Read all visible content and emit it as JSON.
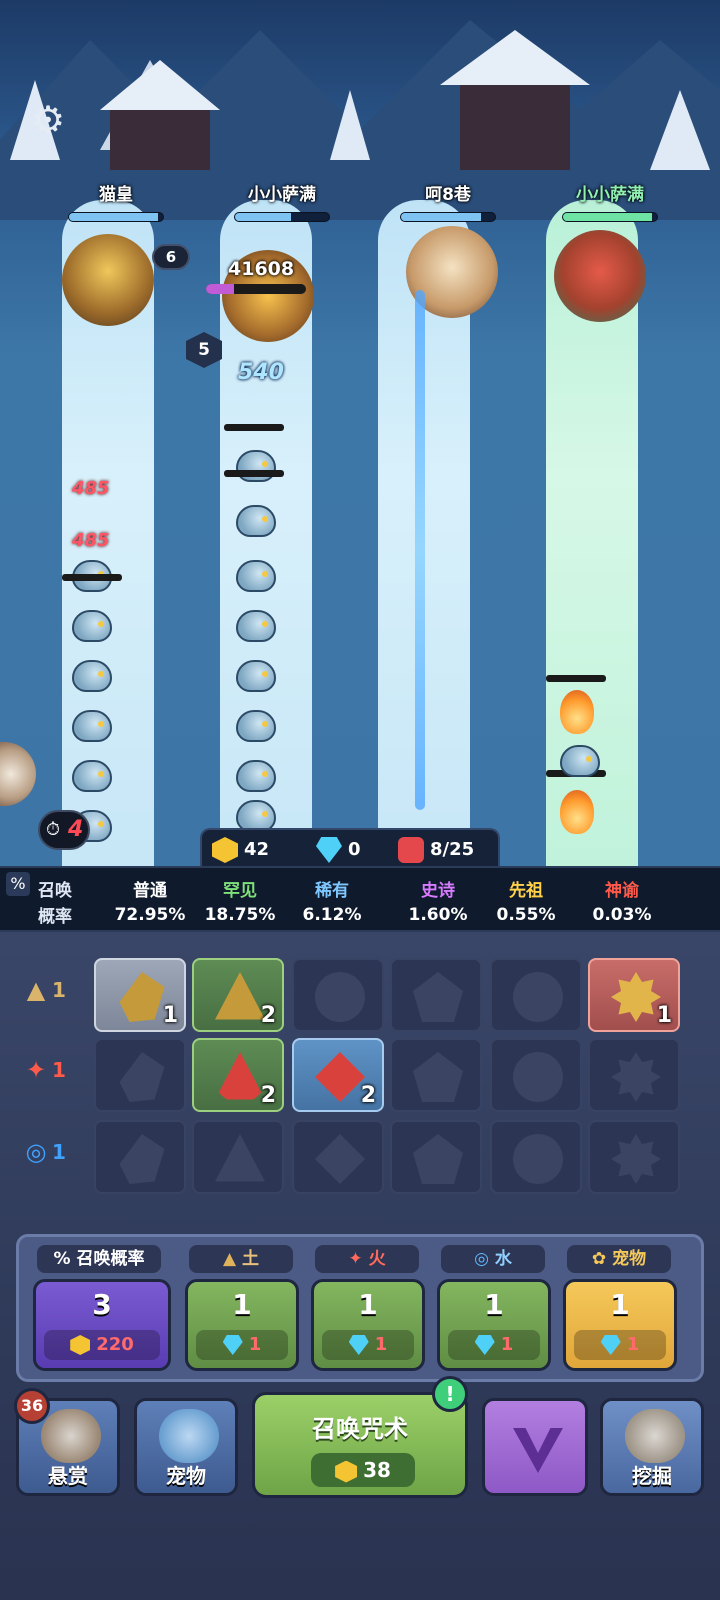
{
  "players": [
    {
      "name": "猫皇",
      "hp_fraction": 0.95,
      "color": "#7fc3f2"
    },
    {
      "name": "小小萨满",
      "hp_fraction": 0.6,
      "color": "#7fc3f2"
    },
    {
      "name": "呵8巷",
      "hp_fraction": 0.85,
      "color": "#7fc3f2"
    },
    {
      "name": "小小萨满",
      "hp_fraction": 0.95,
      "color": "#6fe3a4"
    }
  ],
  "battle": {
    "hero_level_badge": "6",
    "hero_hex_badge": "5",
    "boss_hp_text": "41608",
    "damage_big": "540",
    "damage_a": "485",
    "damage_b": "485",
    "timer_value": "4"
  },
  "resources": {
    "gold": "42",
    "gems": "0",
    "units": "8/25"
  },
  "summon_rates": {
    "label_line1": "召唤",
    "label_line2": "概率",
    "tiers": [
      {
        "name": "普通",
        "rate": "72.95%",
        "color": "#ffffff"
      },
      {
        "name": "罕见",
        "rate": "18.75%",
        "color": "#7fe07a"
      },
      {
        "name": "稀有",
        "rate": "6.12%",
        "color": "#7fc7ff"
      },
      {
        "name": "史诗",
        "rate": "1.60%",
        "color": "#d77bff"
      },
      {
        "name": "先祖",
        "rate": "0.55%",
        "color": "#ffd24a"
      },
      {
        "name": "神谕",
        "rate": "0.03%",
        "color": "#ff5a4a"
      }
    ]
  },
  "rows": [
    {
      "element": "earth",
      "icon": "mountain-icon",
      "level": "1",
      "slots": [
        {
          "count": "1",
          "style": "grey",
          "shape": "leaf",
          "rune": "earth"
        },
        {
          "count": "2",
          "style": "green",
          "shape": "tri",
          "rune": "earth"
        },
        {
          "count": "",
          "style": "",
          "shape": "circ",
          "rune": ""
        },
        {
          "count": "",
          "style": "",
          "shape": "pent",
          "rune": ""
        },
        {
          "count": "",
          "style": "",
          "shape": "circ",
          "rune": ""
        },
        {
          "count": "1",
          "style": "red",
          "shape": "star",
          "rune": "earthgold"
        }
      ]
    },
    {
      "element": "fire",
      "icon": "fire-icon",
      "level": "1",
      "slots": [
        {
          "count": "",
          "style": "",
          "shape": "leaf",
          "rune": ""
        },
        {
          "count": "2",
          "style": "green",
          "shape": "tri",
          "rune": "fire"
        },
        {
          "count": "2",
          "style": "blue",
          "shape": "dia",
          "rune": "fire"
        },
        {
          "count": "",
          "style": "",
          "shape": "pent",
          "rune": ""
        },
        {
          "count": "",
          "style": "",
          "shape": "circ",
          "rune": ""
        },
        {
          "count": "",
          "style": "",
          "shape": "star",
          "rune": ""
        }
      ]
    },
    {
      "element": "water",
      "icon": "water-swirl-icon",
      "level": "1",
      "slots": [
        {
          "count": "",
          "style": "",
          "shape": "leaf",
          "rune": ""
        },
        {
          "count": "",
          "style": "",
          "shape": "tri",
          "rune": ""
        },
        {
          "count": "",
          "style": "",
          "shape": "dia",
          "rune": ""
        },
        {
          "count": "",
          "style": "",
          "shape": "pent",
          "rune": ""
        },
        {
          "count": "",
          "style": "",
          "shape": "circ",
          "rune": ""
        },
        {
          "count": "",
          "style": "",
          "shape": "star",
          "rune": ""
        }
      ]
    }
  ],
  "upgrades": {
    "summon_rate": {
      "header": "召唤概率",
      "level": "3",
      "cost": "220"
    },
    "earth": {
      "header": "土",
      "level": "1",
      "cost": "1"
    },
    "fire": {
      "header": "火",
      "level": "1",
      "cost": "1"
    },
    "water": {
      "header": "水",
      "level": "1",
      "cost": "1"
    },
    "pet": {
      "header": "宠物",
      "level": "1",
      "cost": "1"
    }
  },
  "nav": {
    "bounty_label": "悬赏",
    "bounty_badge": "36",
    "pet_label": "宠物",
    "summon_label": "召唤咒术",
    "summon_cost": "38",
    "summon_alert": "!",
    "dig_label": "挖掘"
  }
}
